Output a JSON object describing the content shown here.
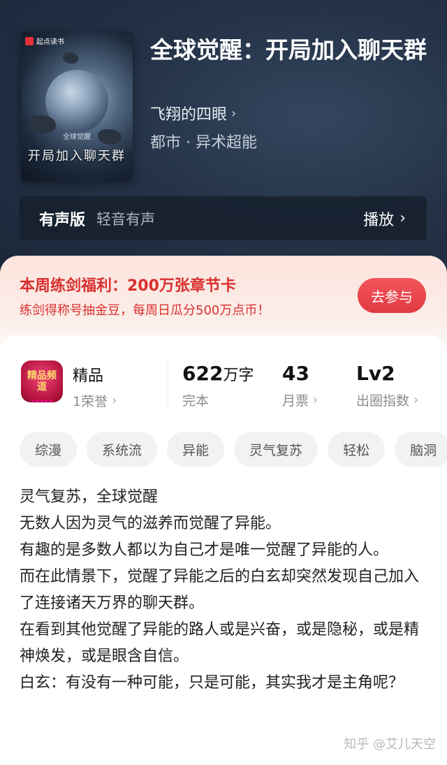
{
  "book": {
    "title": "全球觉醒：开局加入聊天群",
    "author": "飞翔的四眼",
    "genre": "都市 · 异术超能",
    "cover": {
      "brand": "起点读书",
      "title": "开局加入聊天群",
      "sub": "全球觉醒"
    }
  },
  "audio": {
    "label": "有声版",
    "provider": "轻音有声",
    "play": "播放"
  },
  "promo": {
    "headline": "本周练剑福利：200万张章节卡",
    "detail": "练剑得称号抽金豆，每周日瓜分500万点币！",
    "button": "去参与"
  },
  "stats": {
    "badge_text": "精品频道",
    "category": "精品",
    "honor": "1荣誉",
    "words_value": "622",
    "words_unit": "万字",
    "words_label": "完本",
    "monthly_value": "43",
    "monthly_label": "月票",
    "level_value": "Lv2",
    "level_label": "出圈指数"
  },
  "tags": [
    "综漫",
    "系统流",
    "异能",
    "灵气复苏",
    "轻松",
    "脑洞"
  ],
  "description": [
    "灵气复苏，全球觉醒",
    "无数人因为灵气的滋养而觉醒了异能。",
    "有趣的是多数人都以为自己才是唯一觉醒了异能的人。",
    "而在此情景下，觉醒了异能之后的白玄却突然发现自己加入了连接诸天万界的聊天群。",
    "在看到其他觉醒了异能的路人或是兴奋，或是隐秘，或是精神焕发，或是眼含自信。",
    "白玄：有没有一种可能，只是可能，其实我才是主角呢？"
  ],
  "watermark": "知乎 @艾儿天空"
}
